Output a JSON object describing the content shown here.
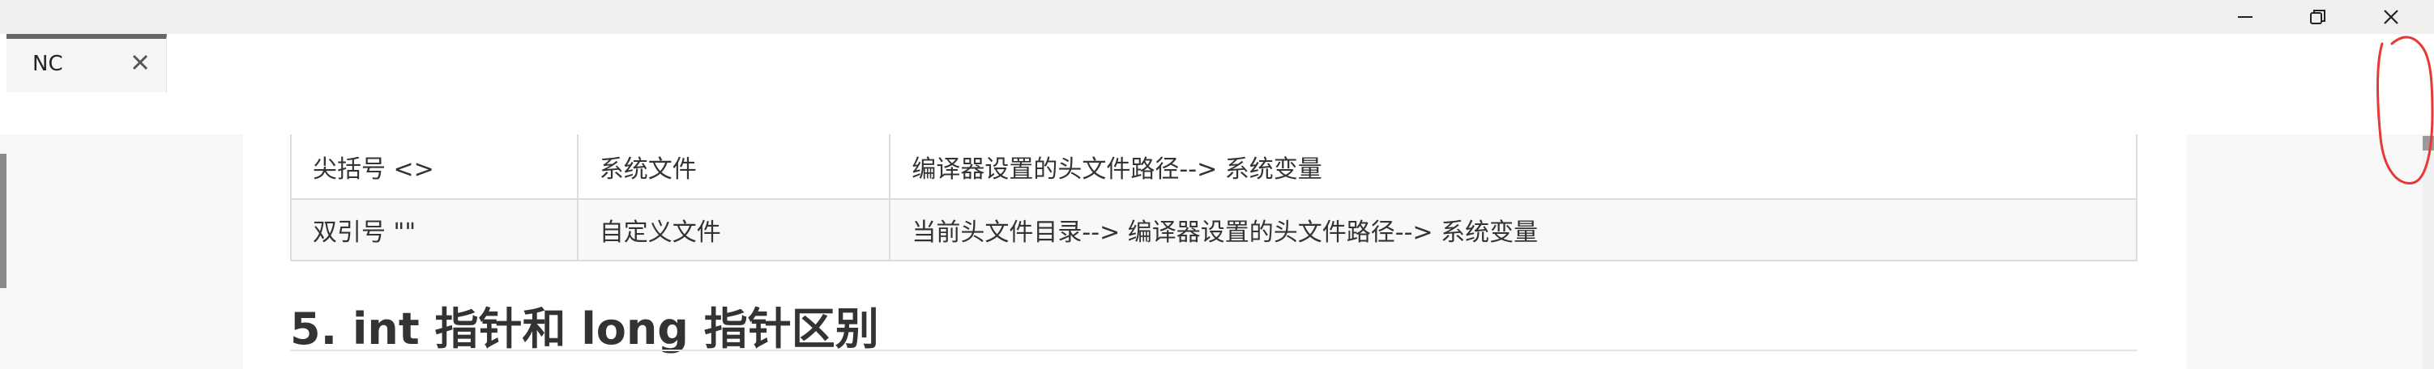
{
  "window": {
    "controls": [
      "minimize-icon",
      "restore-icon",
      "close-icon"
    ]
  },
  "tabs": [
    {
      "label": "NC",
      "close_icon": "close-icon"
    }
  ],
  "table": {
    "rows": [
      [
        "尖括号 <>",
        "系统文件",
        "编译器设置的头文件路径--> 系统变量"
      ],
      [
        "双引号 \"\"",
        "自定义文件",
        "当前头文件目录--> 编译器设置的头文件路径--> 系统变量"
      ]
    ]
  },
  "section_heading": "5. int 指针和 long 指针区别",
  "colors": {
    "titlebar": "#f0efee",
    "annotation_stroke": "#e53935",
    "text": "#333333"
  }
}
